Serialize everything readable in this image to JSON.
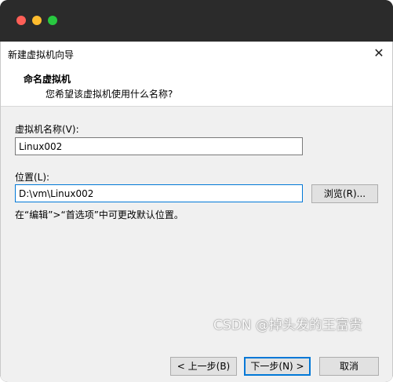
{
  "window": {
    "title": "新建虚拟机向导",
    "close_glyph": "✕"
  },
  "header": {
    "title": "命名虚拟机",
    "subtitle": "您希望该虚拟机使用什么名称?"
  },
  "form": {
    "name_label": "虚拟机名称(V):",
    "name_value": "Linux002",
    "location_label": "位置(L):",
    "location_value": "D:\\vm\\Linux002",
    "browse_label": "浏览(R)...",
    "hint": "在“编辑”>“首选项”中可更改默认位置。"
  },
  "footer": {
    "back_label": "< 上一步(B)",
    "next_label": "下一步(N) >",
    "cancel_label": "取消"
  },
  "watermark": "CSDN @掉头发的王富贵",
  "colors": {
    "accent": "#0078d7",
    "dialog_bg": "#f0f0f0",
    "mac_titlebar": "#2b2b2b",
    "traffic_red": "#ff5f57",
    "traffic_yellow": "#febc2e",
    "traffic_green": "#28c840"
  }
}
